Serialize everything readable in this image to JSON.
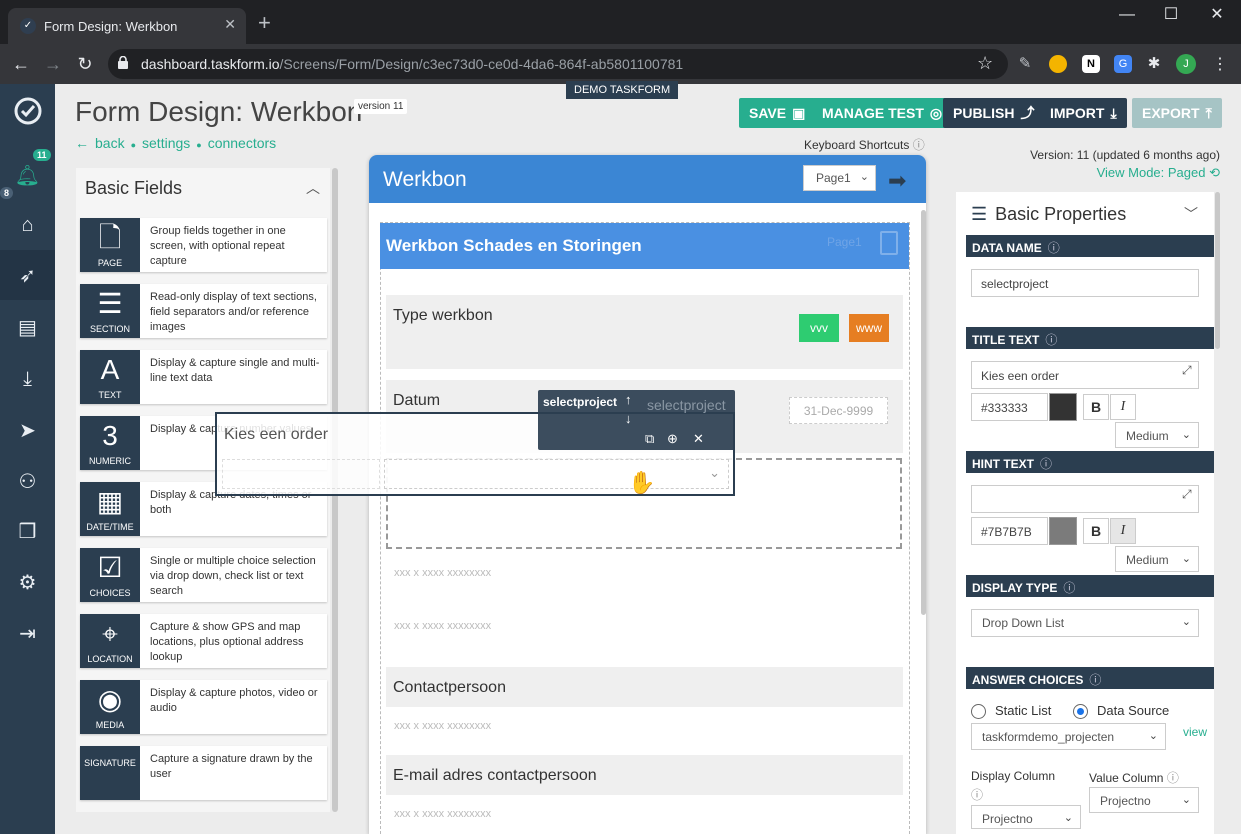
{
  "browser": {
    "tab_title": "Form Design: Werkbon",
    "url_host": "dashboard.taskform.io",
    "url_path": "/Screens/Form/Design/c3ec73d0-ce0d-4da6-864f-ab5801100781",
    "avatar_letter": "J"
  },
  "app": {
    "notification_count": "11",
    "side_badge": "8",
    "page_title": "Form Design: Werkbon",
    "version_tag": "version 11",
    "demo_label": "DEMO TASKFORM",
    "breadcrumbs": [
      "back",
      "settings",
      "connectors"
    ],
    "toolbar": {
      "save": "SAVE",
      "manage_test": "MANAGE TEST",
      "publish": "PUBLISH",
      "import": "IMPORT",
      "export": "EXPORT"
    },
    "keyboard_shortcuts": "Keyboard Shortcuts",
    "version_info": "Version: 11 (updated 6 months ago)",
    "view_mode": "View Mode: Paged",
    "colors": {
      "accent": "#27ae8f",
      "navy": "#2b3e50",
      "blue": "#3b86d4",
      "disabled": "#a6c4c5"
    }
  },
  "basic_fields": {
    "title": "Basic Fields",
    "items": [
      {
        "label": "PAGE",
        "glyph": "🗋",
        "desc": "Group fields together in one screen, with optional repeat capture"
      },
      {
        "label": "SECTION",
        "glyph": "☰",
        "desc": "Read-only display of text sections, field separators and/or reference images"
      },
      {
        "label": "TEXT",
        "glyph": "A",
        "desc": "Display & capture single and multi-line text data"
      },
      {
        "label": "NUMERIC",
        "glyph": "3",
        "desc": "Display & capture number values"
      },
      {
        "label": "DATE/TIME",
        "glyph": "▦",
        "desc": "Display & capture dates, times or both"
      },
      {
        "label": "CHOICES",
        "glyph": "☑",
        "desc": "Single or multiple choice selection via drop down, check list or text search"
      },
      {
        "label": "LOCATION",
        "glyph": "⌖",
        "desc": "Capture & show GPS and map locations, plus optional address lookup"
      },
      {
        "label": "MEDIA",
        "glyph": "◉",
        "desc": "Display & capture photos, video or audio"
      },
      {
        "label": "SIGNATURE",
        "glyph": "",
        "desc": "Capture a signature drawn by the user"
      }
    ]
  },
  "form": {
    "header": "Werkbon",
    "page_select": "Page1",
    "section_title": "Werkbon Schades en Storingen",
    "section_page": "Page1",
    "questions": {
      "type_werkbon": "Type werkbon",
      "datum": "Datum",
      "date_placeholder": "31-Dec-9999",
      "contactpersoon": "Contactpersoon",
      "email": "E-mail adres contactpersoon"
    },
    "chips": [
      "vvv",
      "www"
    ],
    "hint_placeholder": "xxx x xxxx xxxxxxxx",
    "floating_field": {
      "title": "Kies een order",
      "tag_name": "selectproject",
      "tag_ghost": "selectproject"
    }
  },
  "properties": {
    "title": "Basic Properties",
    "data_name_label": "DATA NAME",
    "data_name_value": "selectproject",
    "title_text_label": "TITLE TEXT",
    "title_text_value": "Kies een order",
    "title_color": "#333333",
    "title_size": "Medium",
    "hint_text_label": "HINT TEXT",
    "hint_text_value": "",
    "hint_color": "#7B7B7B",
    "hint_size": "Medium",
    "display_type_label": "DISPLAY TYPE",
    "display_type_value": "Drop Down List",
    "answer_choices_label": "ANSWER CHOICES",
    "opt_static": "Static List",
    "opt_datasource": "Data Source",
    "datasource_value": "taskformdemo_projecten",
    "view_link": "view",
    "display_column_label": "Display Column",
    "display_column_value": "Projectno",
    "value_column_label": "Value Column",
    "value_column_value": "Projectno",
    "bold": "B",
    "italic": "I"
  }
}
